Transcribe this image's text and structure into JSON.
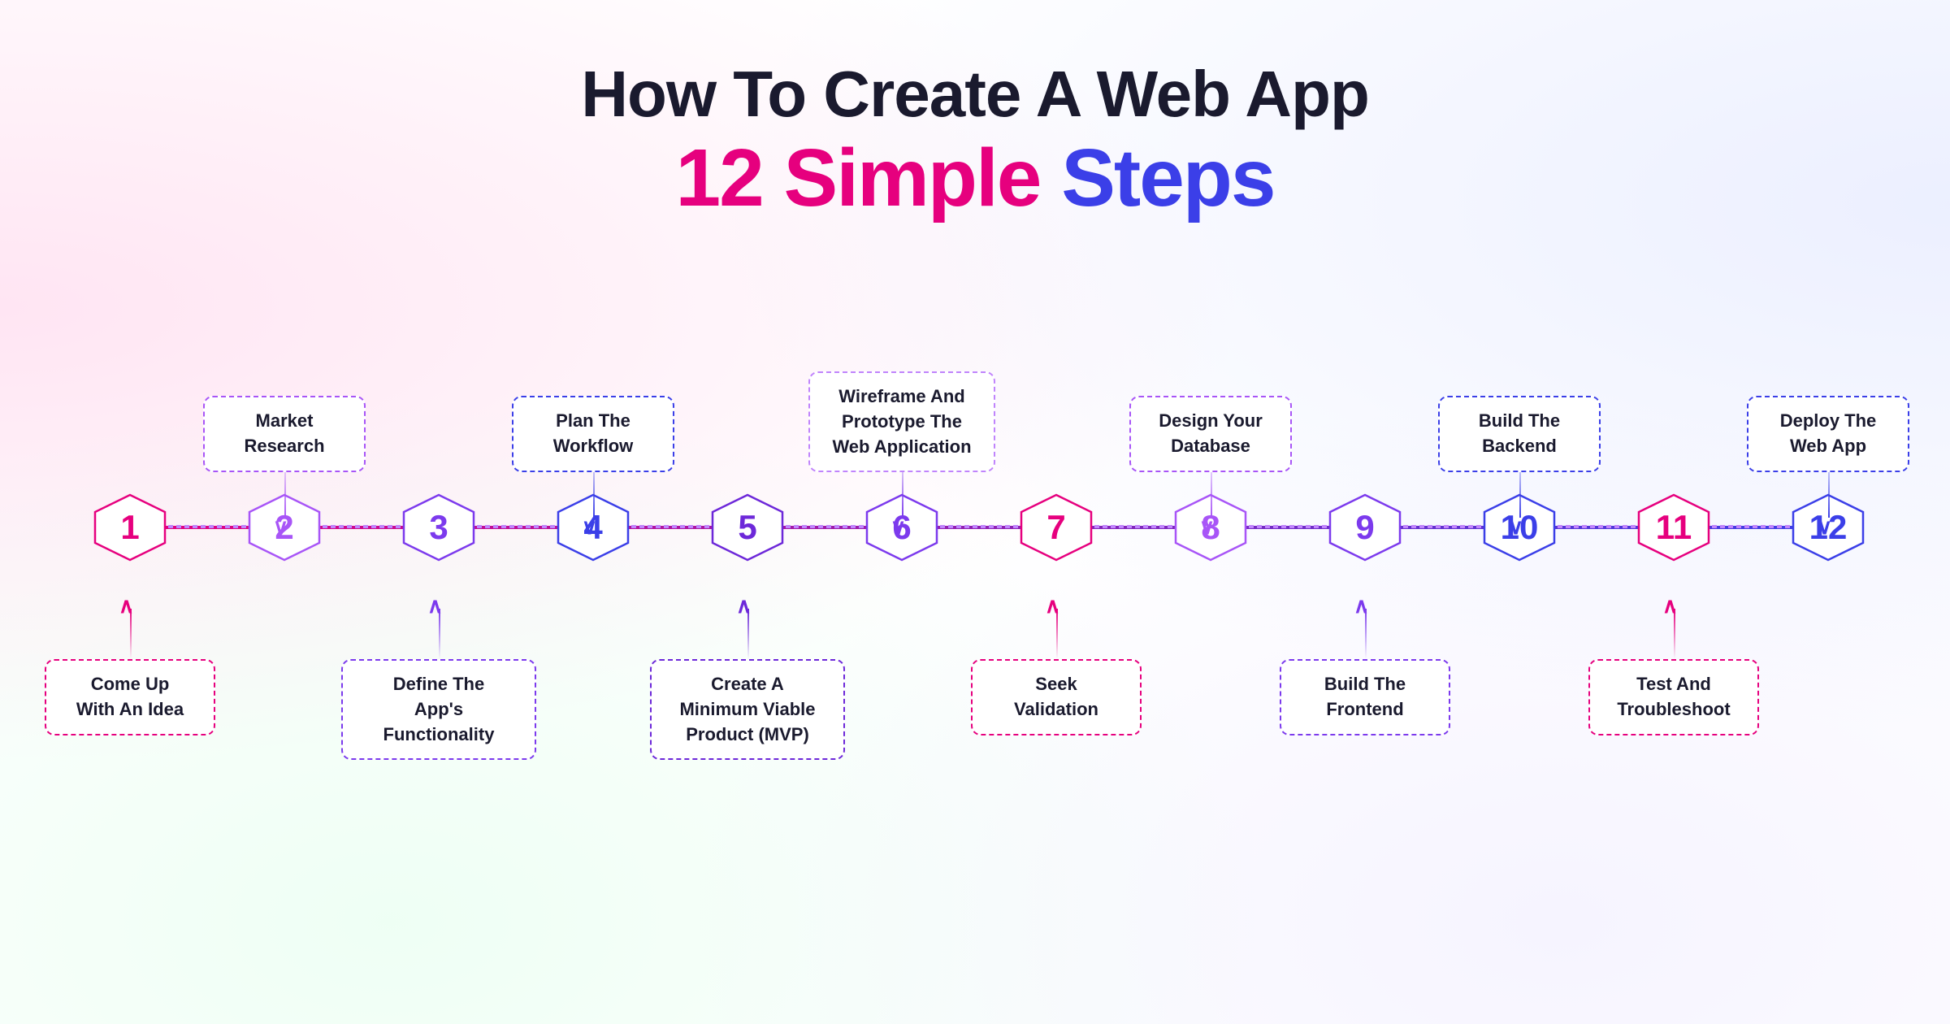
{
  "title": {
    "line1": "How To Create A Web App",
    "line2_pink": "12 Simple",
    "line2_blue": "Steps"
  },
  "steps": [
    {
      "number": "1",
      "color": "#e6007e",
      "label_below": "Come Up\nWith An Idea",
      "label_above": null
    },
    {
      "number": "2",
      "color": "#a855f7",
      "label_below": null,
      "label_above": "Market\nResearch"
    },
    {
      "number": "3",
      "color": "#7c3aed",
      "label_below": "Define The\nApp's\nFunctionality",
      "label_above": null
    },
    {
      "number": "4",
      "color": "#3b3fe8",
      "label_below": null,
      "label_above": "Plan The\nWorkflow"
    },
    {
      "number": "5",
      "color": "#6d28d9",
      "label_below": "Create A\nMinimum Viable\nProduct (MVP)",
      "label_above": null
    },
    {
      "number": "6",
      "color": "#7c3aed",
      "label_below": null,
      "label_above": "Wireframe And\nPrototype The\nWeb Application"
    },
    {
      "number": "7",
      "color": "#e6007e",
      "label_below": "Seek\nValidation",
      "label_above": null
    },
    {
      "number": "8",
      "color": "#a855f7",
      "label_below": null,
      "label_above": "Design Your\nDatabase"
    },
    {
      "number": "9",
      "color": "#7c3aed",
      "label_below": "Build The\nFrontend",
      "label_above": null
    },
    {
      "number": "10",
      "color": "#3b3fe8",
      "label_below": null,
      "label_above": "Build The\nBackend"
    },
    {
      "number": "11",
      "color": "#e6007e",
      "label_below": "Test And\nTroubleshoot",
      "label_above": null
    },
    {
      "number": "12",
      "color": "#3b3fe8",
      "label_below": null,
      "label_above": "Deploy The\nWeb App"
    }
  ]
}
